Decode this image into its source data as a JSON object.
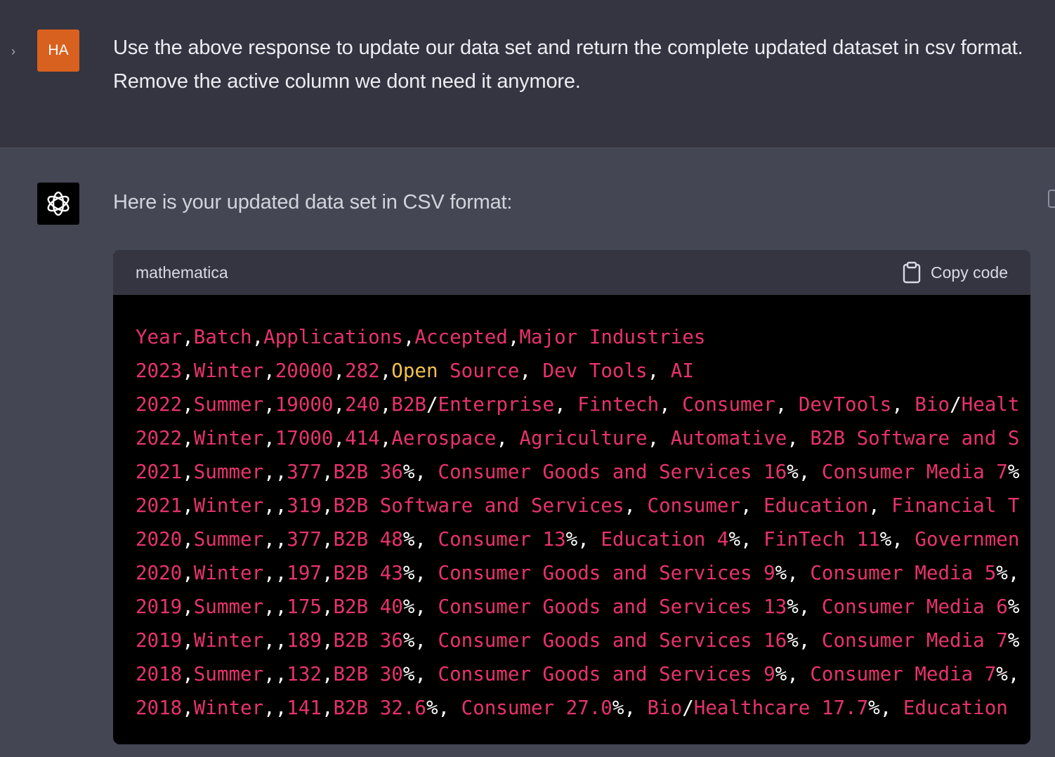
{
  "user": {
    "avatar_initials": "HA",
    "message": "Use the above response to update our data set and return the complete updated dataset in csv format. Remove the active column we dont need it anymore."
  },
  "assistant": {
    "intro": "Here is your updated data set in CSV format:",
    "code_block": {
      "language": "mathematica",
      "copy_label": "Copy code",
      "lines": [
        "Year,Batch,Applications,Accepted,Major Industries",
        "2023,Winter,20000,282,Open Source, Dev Tools, AI",
        "2022,Summer,19000,240,B2B/Enterprise, Fintech, Consumer, DevTools, Bio/Healt",
        "2022,Winter,17000,414,Aerospace, Agriculture, Automative, B2B Software and S",
        "2021,Summer,,377,B2B 36%, Consumer Goods and Services 16%, Consumer Media 7%",
        "2021,Winter,,319,B2B Software and Services, Consumer, Education, Financial T",
        "2020,Summer,,377,B2B 48%, Consumer 13%, Education 4%, FinTech 11%, Governmen",
        "2020,Winter,,197,B2B 43%, Consumer Goods and Services 9%, Consumer Media 5%,",
        "2019,Summer,,175,B2B 40%, Consumer Goods and Services 13%, Consumer Media 6%",
        "2019,Winter,,189,B2B 36%, Consumer Goods and Services 16%, Consumer Media 7%",
        "2018,Summer,,132,B2B 30%, Consumer Goods and Services 9%, Consumer Media 7%,",
        "2018,Winter,,141,B2B 32.6%, Consumer 27.0%, Bio/Healthcare 17.7%, Education "
      ]
    }
  },
  "colors": {
    "code_token": "#e8336c",
    "code_punct": "#ffffff",
    "code_keyword": "#f2c14e",
    "user_avatar": "#d9611f"
  }
}
